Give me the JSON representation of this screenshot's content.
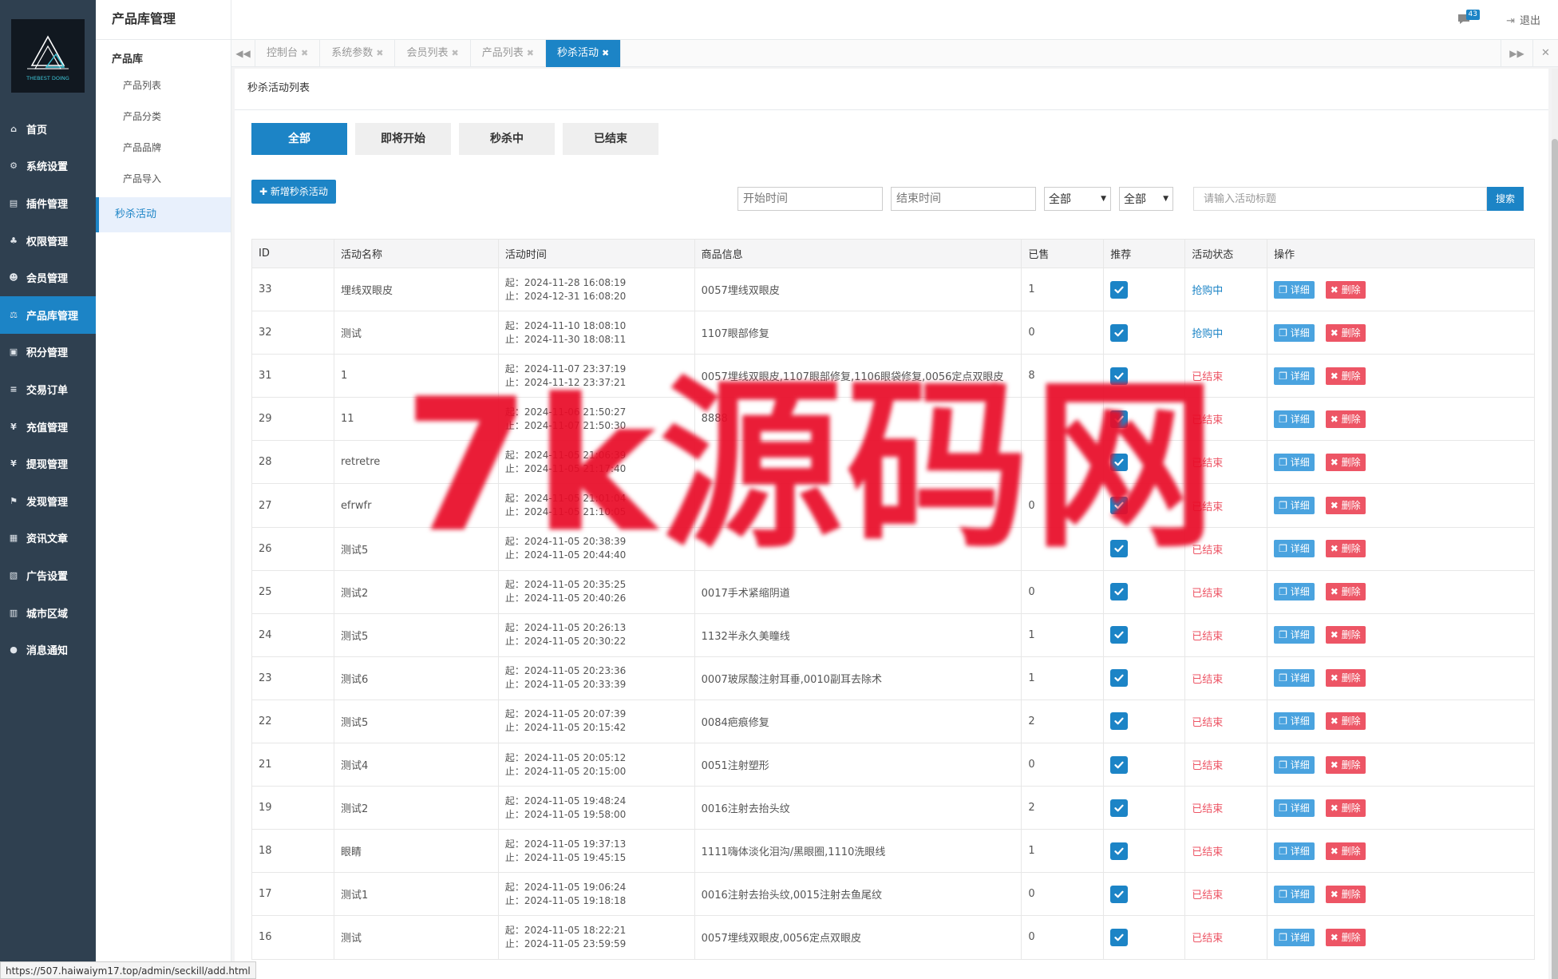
{
  "logo": {
    "text": "THEBEST DOING"
  },
  "sidebar": {
    "items": [
      {
        "label": "首页",
        "icon": "home-icon",
        "glyph": "⌂"
      },
      {
        "label": "系统设置",
        "icon": "gear-icon",
        "glyph": "⚙"
      },
      {
        "label": "插件管理",
        "icon": "plugin-icon",
        "glyph": "▤"
      },
      {
        "label": "权限管理",
        "icon": "sitemap-icon",
        "glyph": "♣"
      },
      {
        "label": "会员管理",
        "icon": "users-icon",
        "glyph": "☻"
      },
      {
        "label": "产品库管理",
        "icon": "balance-icon",
        "glyph": "⚖"
      },
      {
        "label": "积分管理",
        "icon": "file-icon",
        "glyph": "▣"
      },
      {
        "label": "交易订单",
        "icon": "order-icon",
        "glyph": "≡"
      },
      {
        "label": "充值管理",
        "icon": "yen-icon",
        "glyph": "¥"
      },
      {
        "label": "提现管理",
        "icon": "yen-icon",
        "glyph": "¥"
      },
      {
        "label": "发现管理",
        "icon": "flag-icon",
        "glyph": "⚑"
      },
      {
        "label": "资讯文章",
        "icon": "news-icon",
        "glyph": "▦"
      },
      {
        "label": "广告设置",
        "icon": "image-icon",
        "glyph": "▧"
      },
      {
        "label": "城市区域",
        "icon": "map-icon",
        "glyph": "▥"
      },
      {
        "label": "消息通知",
        "icon": "comment-icon",
        "glyph": "●"
      }
    ]
  },
  "subbar": {
    "title": "产品库管理",
    "group": "产品库",
    "items": [
      "产品列表",
      "产品分类",
      "产品品牌",
      "产品导入",
      "秒杀活动"
    ]
  },
  "header": {
    "badge": "43",
    "logout": "退出"
  },
  "tabs": [
    "控制台",
    "系统参数",
    "会员列表",
    "产品列表",
    "秒杀活动"
  ],
  "page": {
    "title": "秒杀活动列表",
    "filters": [
      "全部",
      "即将开始",
      "秒杀中",
      "已结束"
    ],
    "add_label": "新增秒杀活动",
    "start_placeholder": "开始时间",
    "end_placeholder": "结束时间",
    "select1": "全部",
    "select2": "全部",
    "keyword_placeholder": "请输入活动标题",
    "search_label": "搜索"
  },
  "table": {
    "headers": [
      "ID",
      "活动名称",
      "活动时间",
      "商品信息",
      "已售",
      "推荐",
      "活动状态",
      "操作"
    ],
    "detail_label": "详细",
    "delete_label": "删除",
    "start_prefix": "起：",
    "end_prefix": "止：",
    "rows": [
      {
        "id": "33",
        "name": "埋线双眼皮",
        "start": "2024-11-28 16:08:19",
        "end": "2024-12-31 16:08:20",
        "goods": "0057埋线双眼皮",
        "sold": "1",
        "status": "抢购中"
      },
      {
        "id": "32",
        "name": "测试",
        "start": "2024-11-10 18:08:10",
        "end": "2024-11-30 18:08:11",
        "goods": "1107眼部修复",
        "sold": "0",
        "status": "抢购中"
      },
      {
        "id": "31",
        "name": "1",
        "start": "2024-11-07 23:37:19",
        "end": "2024-11-12 23:37:21",
        "goods": "0057埋线双眼皮,1107眼部修复,1106眼袋修复,0056定点双眼皮",
        "sold": "8",
        "status": "已结束"
      },
      {
        "id": "29",
        "name": "11",
        "start": "2024-11-06 21:50:27",
        "end": "2024-11-07 21:50:30",
        "goods": "8888",
        "sold": "",
        "status": "已结束"
      },
      {
        "id": "28",
        "name": "retretre",
        "start": "2024-11-05 21:06:39",
        "end": "2024-11-05 21:17:40",
        "goods": "",
        "sold": "",
        "status": "已结束"
      },
      {
        "id": "27",
        "name": "efrwfr",
        "start": "2024-11-05 21:01:04",
        "end": "2024-11-05 21:10:05",
        "goods": "",
        "sold": "0",
        "status": "已结束"
      },
      {
        "id": "26",
        "name": "测试5",
        "start": "2024-11-05 20:38:39",
        "end": "2024-11-05 20:44:40",
        "goods": "",
        "sold": "",
        "status": "已结束"
      },
      {
        "id": "25",
        "name": "测试2",
        "start": "2024-11-05 20:35:25",
        "end": "2024-11-05 20:40:26",
        "goods": "0017手术紧缩阴道",
        "sold": "0",
        "status": "已结束"
      },
      {
        "id": "24",
        "name": "测试5",
        "start": "2024-11-05 20:26:13",
        "end": "2024-11-05 20:30:22",
        "goods": "1132半永久美瞳线",
        "sold": "1",
        "status": "已结束"
      },
      {
        "id": "23",
        "name": "测试6",
        "start": "2024-11-05 20:23:36",
        "end": "2024-11-05 20:33:39",
        "goods": "0007玻尿酸注射耳垂,0010副耳去除术",
        "sold": "1",
        "status": "已结束"
      },
      {
        "id": "22",
        "name": "测试5",
        "start": "2024-11-05 20:07:39",
        "end": "2024-11-05 20:15:42",
        "goods": "0084疤痕修复",
        "sold": "2",
        "status": "已结束"
      },
      {
        "id": "21",
        "name": "测试4",
        "start": "2024-11-05 20:05:12",
        "end": "2024-11-05 20:15:00",
        "goods": "0051注射塑形",
        "sold": "0",
        "status": "已结束"
      },
      {
        "id": "19",
        "name": "测试2",
        "start": "2024-11-05 19:48:24",
        "end": "2024-11-05 19:58:00",
        "goods": "0016注射去抬头纹",
        "sold": "2",
        "status": "已结束"
      },
      {
        "id": "18",
        "name": "眼睛",
        "start": "2024-11-05 19:37:13",
        "end": "2024-11-05 19:45:15",
        "goods": "1111嗨体淡化泪沟/黑眼圈,1110洗眼线",
        "sold": "1",
        "status": "已结束"
      },
      {
        "id": "17",
        "name": "测试1",
        "start": "2024-11-05 19:06:24",
        "end": "2024-11-05 19:18:18",
        "goods": "0016注射去抬头纹,0015注射去鱼尾纹",
        "sold": "0",
        "status": "已结束"
      },
      {
        "id": "16",
        "name": "测试",
        "start": "2024-11-05 18:22:21",
        "end": "2024-11-05 23:59:59",
        "goods": "0057埋线双眼皮,0056定点双眼皮",
        "sold": "0",
        "status": "已结束"
      }
    ]
  },
  "status_url": "https://507.haiwaiym17.top/admin/seckill/add.html",
  "watermark": "7k源码网",
  "colors": {
    "sidebar": "#2f4050",
    "accent": "#1c84c6",
    "danger": "#ed5565"
  }
}
